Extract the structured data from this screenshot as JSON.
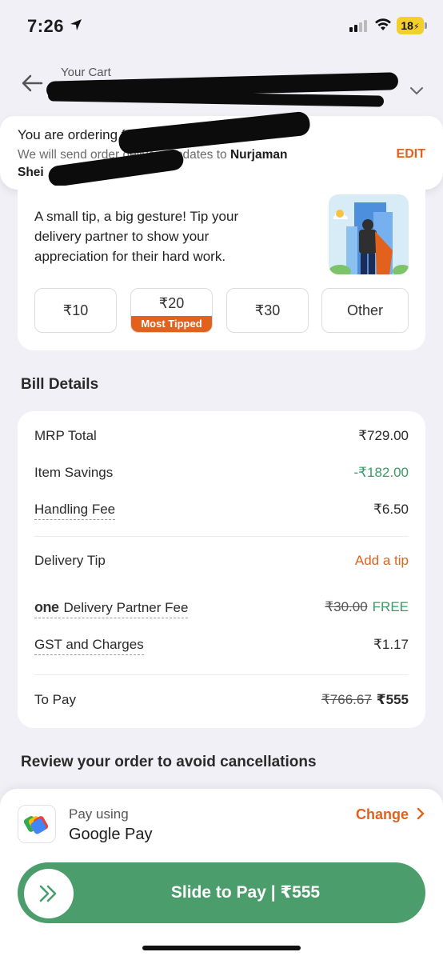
{
  "status_bar": {
    "time": "7:26",
    "battery": "18"
  },
  "header": {
    "subtitle": "Your Cart"
  },
  "order_card": {
    "title": "You are ordering f",
    "desc_prefix": "We will send order",
    "desc_middle": " delivery updates to ",
    "desc_name": "Nurjaman",
    "desc_line2": "Shei",
    "edit": "EDIT"
  },
  "tip": {
    "text": "A small tip, a big gesture! Tip your delivery partner to show your appreciation for their hard work.",
    "options": [
      {
        "label": "₹10"
      },
      {
        "label": "₹20",
        "badge": "Most Tipped"
      },
      {
        "label": "₹30"
      },
      {
        "label": "Other"
      }
    ]
  },
  "bill": {
    "heading": "Bill Details",
    "rows": [
      {
        "label": "MRP Total",
        "value": "₹729.00"
      },
      {
        "label": "Item Savings",
        "value": "-₹182.00"
      },
      {
        "label": "Handling Fee",
        "value": "₹6.50"
      },
      {
        "label": "Delivery Tip",
        "value": "Add a tip"
      },
      {
        "logo": "one",
        "label": "Delivery Partner Fee",
        "strike": "₹30.00",
        "value": "FREE"
      },
      {
        "label": "GST and Charges",
        "value": "₹1.17"
      },
      {
        "label": "To Pay",
        "strike": "₹766.67",
        "value": "₹555"
      }
    ]
  },
  "review": {
    "text": "Review your order to avoid cancellations"
  },
  "payment": {
    "pay_using": "Pay using",
    "method": "Google Pay",
    "change": "Change",
    "slide_label": "Slide to Pay | ₹555"
  },
  "colors": {
    "accent": "#e2621d",
    "green": "#3a9b66",
    "slide": "#4b9d6c",
    "background": "#f1f0f6"
  }
}
